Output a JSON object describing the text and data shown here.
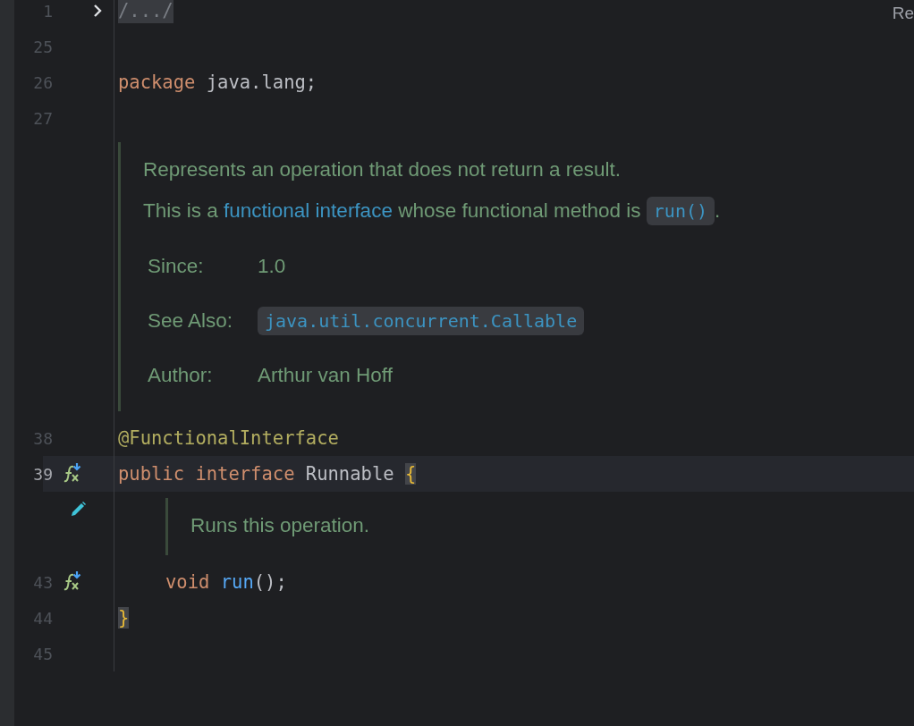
{
  "editor": {
    "corner_label": "Re",
    "lines": [
      {
        "kind": "code",
        "number": "1",
        "folded": true,
        "tokens": [
          {
            "text": "/.../",
            "kind": "folded"
          }
        ]
      },
      {
        "kind": "code",
        "number": "25"
      },
      {
        "kind": "code",
        "number": "26",
        "tokens": [
          {
            "text": "package",
            "kind": "keyword"
          },
          {
            "text": " java.lang;",
            "kind": "plain"
          }
        ]
      },
      {
        "kind": "code",
        "number": "27"
      },
      {
        "kind": "doc",
        "edit_marker": false,
        "paragraphs": [
          [
            {
              "text": "Represents an operation that does not return a result."
            }
          ],
          [
            {
              "text": "This is a "
            },
            {
              "text": "functional interface",
              "kind": "link"
            },
            {
              "text": " whose functional method is "
            },
            {
              "text": "run()",
              "kind": "code"
            },
            {
              "text": "."
            }
          ]
        ],
        "tags": [
          {
            "label": "Since:",
            "value": [
              {
                "text": "1.0"
              }
            ]
          },
          {
            "label": "See Also:",
            "value": [
              {
                "text": "java.util.concurrent.Callable",
                "kind": "code"
              }
            ]
          },
          {
            "label": "Author:",
            "value": [
              {
                "text": "Arthur van Hoff"
              }
            ]
          }
        ]
      },
      {
        "kind": "code",
        "number": "38",
        "tokens": [
          {
            "text": "@FunctionalInterface",
            "kind": "annotation"
          }
        ]
      },
      {
        "kind": "code",
        "number": "39",
        "current": true,
        "implementation_marker": true,
        "tokens": [
          {
            "text": "public",
            "kind": "keyword"
          },
          {
            "text": " interface",
            "kind": "keyword"
          },
          {
            "text": " Runnable ",
            "kind": "plain"
          },
          {
            "text": "{",
            "kind": "brace_match"
          }
        ],
        "children": [
          {
            "kind": "doc",
            "edit_marker": true,
            "paragraphs": [
              [
                {
                  "text": "Runs this operation."
                }
              ]
            ]
          },
          {
            "kind": "code",
            "number": "43",
            "implementation_marker": true,
            "tokens": [
              {
                "text": "void",
                "kind": "keyword"
              },
              {
                "text": " run",
                "kind": "method"
              },
              {
                "text": "();",
                "kind": "plain"
              }
            ]
          }
        ]
      },
      {
        "kind": "code",
        "number": "44",
        "tokens": [
          {
            "text": "}",
            "kind": "brace_match"
          }
        ]
      },
      {
        "kind": "code",
        "number": "45"
      }
    ]
  }
}
